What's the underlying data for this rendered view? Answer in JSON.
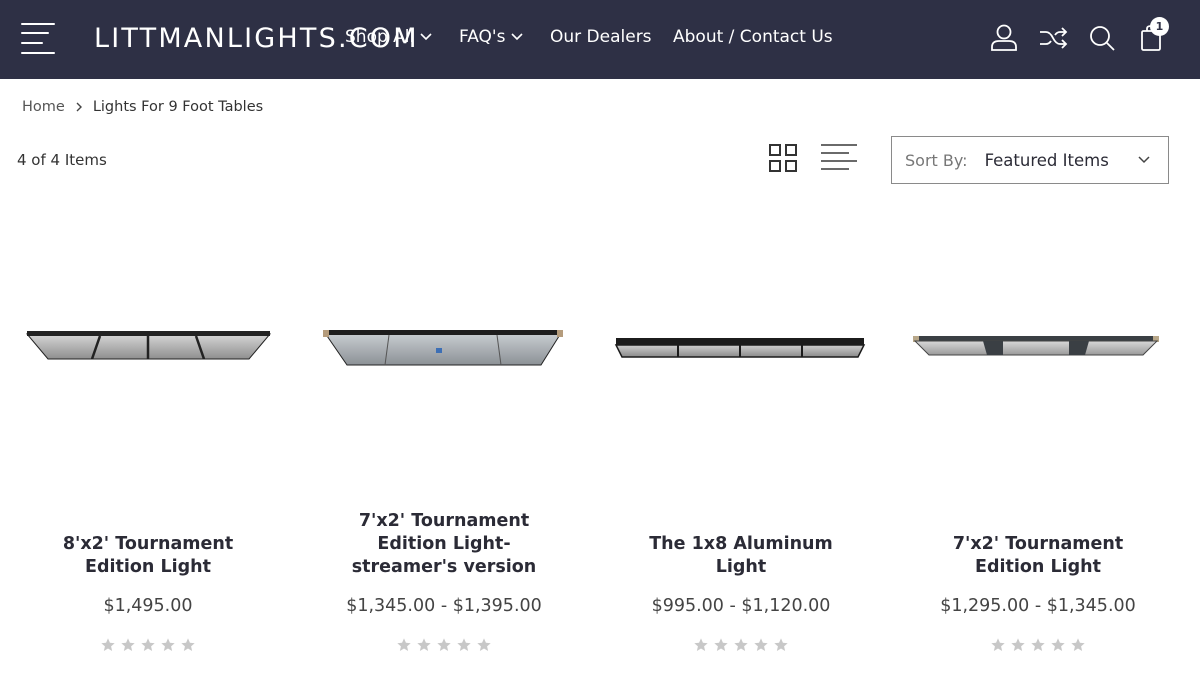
{
  "header": {
    "logo": "LITTMANLIGHTS.COM",
    "nav": [
      {
        "label": "Shop All",
        "has_dropdown": true
      },
      {
        "label": "FAQ's",
        "has_dropdown": true
      },
      {
        "label": "Our Dealers",
        "has_dropdown": false
      },
      {
        "label": "About / Contact Us",
        "has_dropdown": false
      }
    ],
    "icons": [
      "account-icon",
      "compare-icon",
      "search-icon",
      "cart-icon"
    ],
    "cart_count": "1"
  },
  "breadcrumb": {
    "home": "Home",
    "current": "Lights For 9 Foot Tables"
  },
  "toolbar": {
    "count_text": "4 of 4 Items",
    "sort_label": "Sort By:",
    "sort_value": "Featured Items"
  },
  "products": [
    {
      "title": "8'x2' Tournament Edition Light",
      "title_lines": [
        "8'x2' Tournament",
        "Edition Light"
      ],
      "price": "$1,495.00",
      "rating": 0
    },
    {
      "title": "7'x2' Tournament Edition Light-streamer's version",
      "title_lines": [
        "7'x2' Tournament",
        "Edition Light-",
        "streamer's version"
      ],
      "price": "$1,345.00 - $1,395.00",
      "rating": 0
    },
    {
      "title": "The 1x8 Aluminum Light",
      "title_lines": [
        "The 1x8 Aluminum",
        "Light"
      ],
      "price": "$995.00 - $1,120.00",
      "rating": 0
    },
    {
      "title": "7'x2' Tournament Edition Light",
      "title_lines": [
        "7'x2' Tournament",
        "Edition Light"
      ],
      "price": "$1,295.00 - $1,345.00",
      "rating": 0
    }
  ],
  "colors": {
    "header_bg": "#2e3045",
    "text": "#2b2b36",
    "star_empty": "#c8c8c8"
  }
}
